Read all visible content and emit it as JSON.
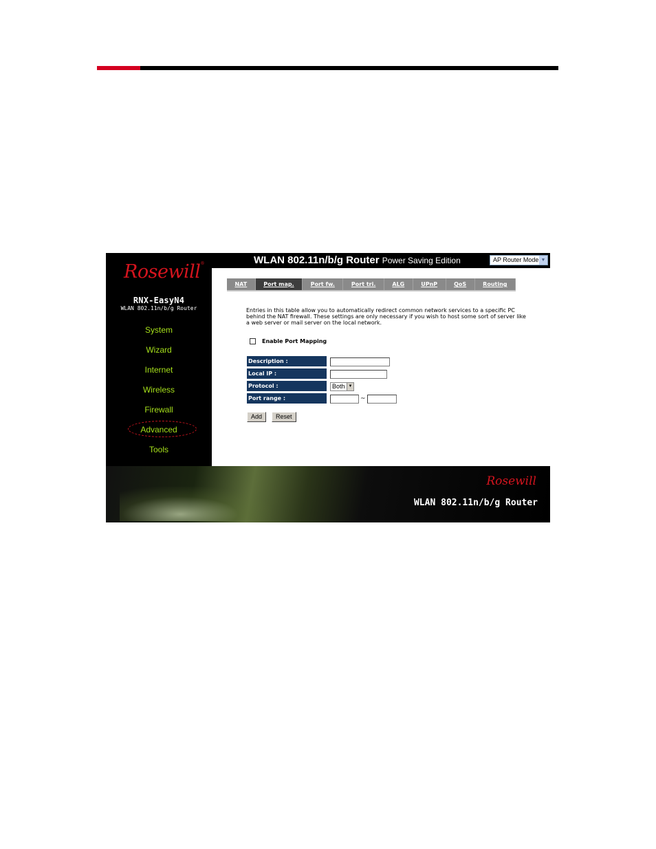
{
  "colors": {
    "accent_red": "#d40020",
    "nav_green": "#a6e01b",
    "label_blue": "#15365e",
    "tab_gray": "#8a8a8a",
    "tab_active": "#3d3d3d"
  },
  "brand": {
    "logo_text": "Rosewill",
    "registered": "®",
    "model": "RNX-EasyN4",
    "model_sub": "WLAN 802.11n/b/g Router"
  },
  "header": {
    "title": "WLAN 802.11n/b/g Router",
    "subtitle": "Power Saving Edition",
    "mode_select": {
      "value": "AP Router Mode",
      "icon": "chevron-down-icon"
    }
  },
  "sidebar": {
    "items": [
      {
        "label": "System",
        "active": false
      },
      {
        "label": "Wizard",
        "active": false
      },
      {
        "label": "Internet",
        "active": false
      },
      {
        "label": "Wireless",
        "active": false
      },
      {
        "label": "Firewall",
        "active": false
      },
      {
        "label": "Advanced",
        "active": true
      },
      {
        "label": "Tools",
        "active": false
      }
    ]
  },
  "tabs": [
    {
      "label": "NAT",
      "active": false
    },
    {
      "label": "Port map.",
      "active": true
    },
    {
      "label": "Port fw.",
      "active": false
    },
    {
      "label": "Port tri.",
      "active": false
    },
    {
      "label": "ALG",
      "active": false
    },
    {
      "label": "UPnP",
      "active": false
    },
    {
      "label": "QoS",
      "active": false
    },
    {
      "label": "Routing",
      "active": false
    }
  ],
  "main": {
    "intro": "Entries in this table allow you to automatically redirect common network services to a specific PC behind the NAT firewall. These settings are only necessary if you wish to host some sort of server like a web server or mail server on the local network.",
    "enable_label": "Enable Port Mapping",
    "enable_checked": false,
    "form": {
      "description_label": "Description :",
      "description_value": "",
      "local_ip_label": "Local IP :",
      "local_ip_value": "",
      "protocol_label": "Protocol :",
      "protocol_value": "Both",
      "port_range_label": "Port range :",
      "port_from": "",
      "port_to": "",
      "range_separator": "~"
    },
    "buttons": {
      "add": "Add",
      "reset": "Reset"
    }
  },
  "footer": {
    "logo_text": "Rosewill",
    "title": "WLAN 802.11n/b/g Router"
  }
}
